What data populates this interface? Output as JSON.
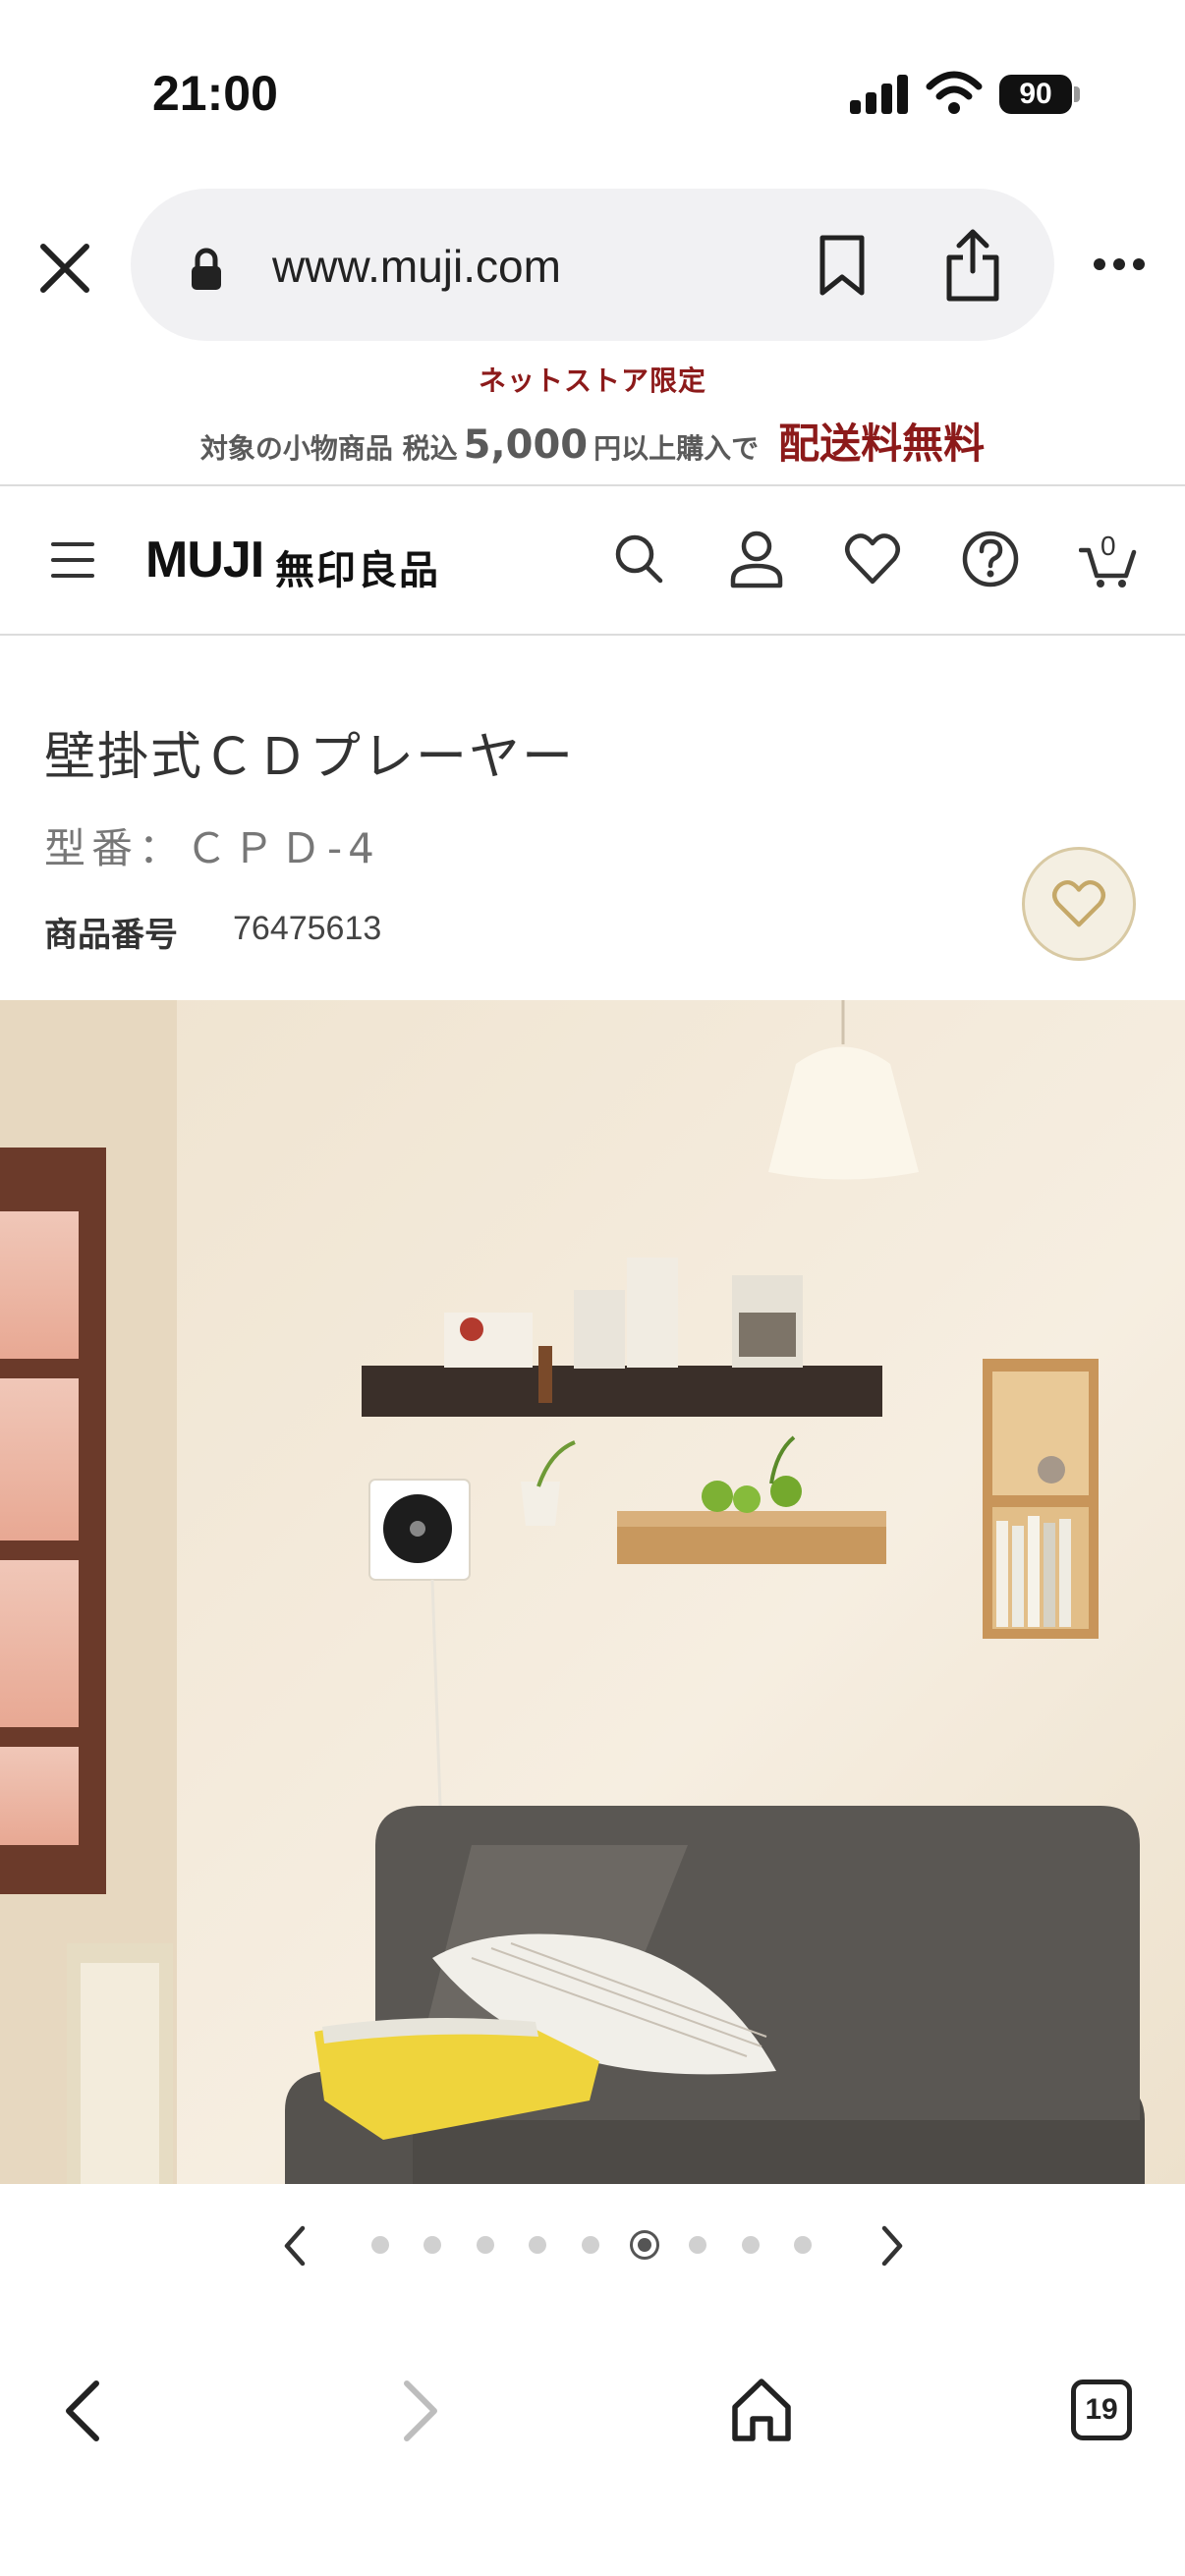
{
  "status_bar": {
    "time": "21:00",
    "battery": "90"
  },
  "browser": {
    "url": "www.muji.com",
    "tab_count": "19"
  },
  "promo": {
    "line1": "ネットストア限定",
    "line2_prefix": "対象の小物商品 税込",
    "line2_amount": "5,000",
    "line2_suffix": "円以上購入で",
    "line2_highlight": "配送料無料"
  },
  "header": {
    "logo_en": "MUJI",
    "logo_jp": "無印良品",
    "cart_count": "0"
  },
  "product": {
    "title": "壁掛式ＣＤプレーヤー",
    "model": "型番：ＣＰＤ-4",
    "number_label": "商品番号",
    "number_value": "76475613"
  },
  "carousel": {
    "total": 9,
    "active_index": 5
  },
  "colors": {
    "accent_red": "#8c1a1a",
    "fav_bg": "#f4efe2"
  },
  "icons": [
    "close-icon",
    "lock-icon",
    "bookmark-icon",
    "share-icon",
    "more-icon",
    "menu-icon",
    "search-icon",
    "user-icon",
    "heart-icon",
    "help-icon",
    "cart-icon",
    "chevron-left-icon",
    "chevron-right-icon",
    "home-icon",
    "tabs-icon"
  ]
}
